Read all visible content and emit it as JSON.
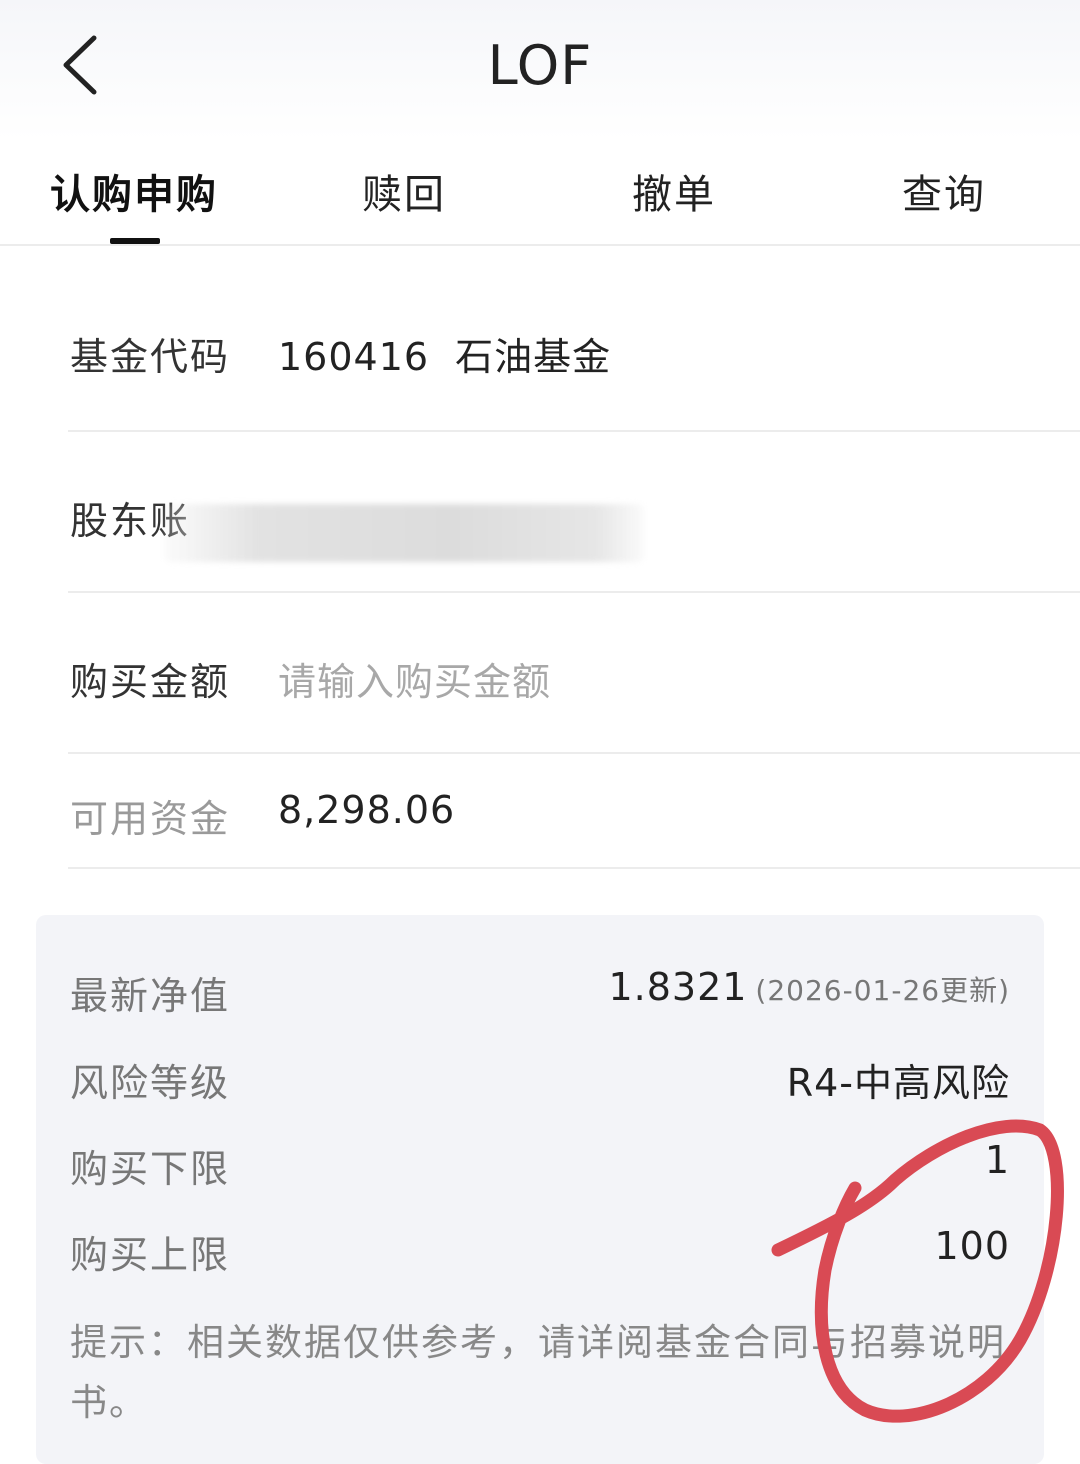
{
  "header": {
    "title": "LOF",
    "back_icon": "chevron-left-icon"
  },
  "tabs": [
    {
      "label": "认购申购",
      "active": true
    },
    {
      "label": "赎回",
      "active": false
    },
    {
      "label": "撤单",
      "active": false
    },
    {
      "label": "查询",
      "active": false
    }
  ],
  "form": {
    "fund_code": {
      "label": "基金代码",
      "code": "160416",
      "name": "石油基金"
    },
    "account": {
      "label": "股东账"
    },
    "amount": {
      "label": "购买金额",
      "placeholder": "请输入购买金额"
    },
    "available": {
      "label": "可用资金",
      "value": "8,298.06"
    }
  },
  "info": {
    "nav": {
      "label": "最新净值",
      "value": "1.8321",
      "note": "(2026-01-26更新)"
    },
    "risk": {
      "label": "风险等级",
      "value": "R4-中高风险"
    },
    "min": {
      "label": "购买下限",
      "value": "1"
    },
    "max": {
      "label": "购买上限",
      "value": "100"
    },
    "tip": "提示：相关数据仅供参考，请详阅基金合同与招募说明书。"
  },
  "colors": {
    "annotation": "#d94a54",
    "card_bg": "#f3f4f8"
  }
}
